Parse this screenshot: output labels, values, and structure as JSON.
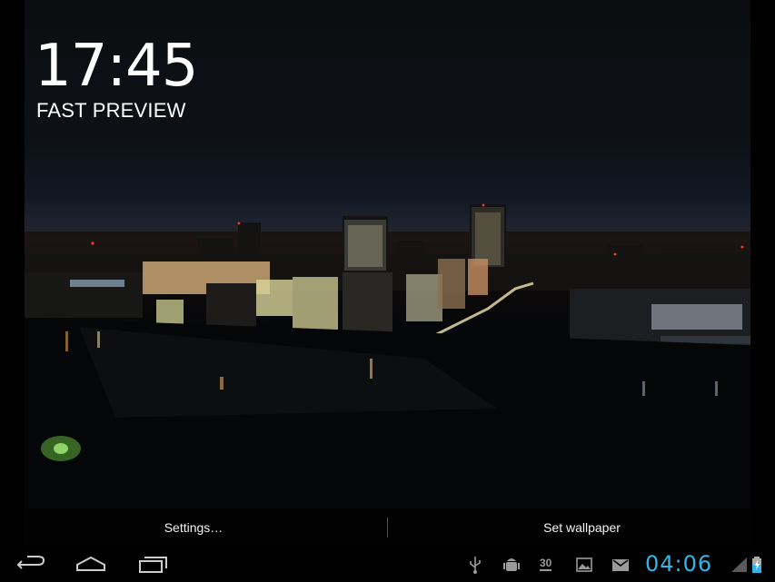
{
  "preview": {
    "clock": "17:45",
    "label": "FAST PREVIEW"
  },
  "actions": {
    "settings_label": "Settings…",
    "set_wallpaper_label": "Set wallpaper"
  },
  "system_bar": {
    "time": "04:06",
    "calendar_day": "30",
    "nav": [
      "back-icon",
      "home-icon",
      "recent-apps-icon"
    ],
    "status_icons": [
      "usb-icon",
      "android-debug-icon",
      "calendar-icon",
      "gallery-icon",
      "gmail-icon",
      "signal-icon",
      "battery-charging-icon"
    ]
  },
  "colors": {
    "clock_accent": "#33b5e5",
    "background": "#000000"
  }
}
